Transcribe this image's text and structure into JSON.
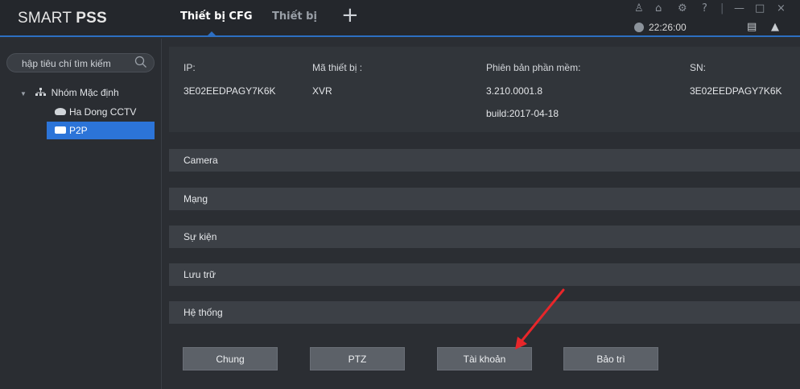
{
  "app": {
    "brand_prefix": "SMART ",
    "brand_bold": "PSS"
  },
  "tabs": [
    {
      "label": "Thiết bị CFG"
    },
    {
      "label": "Thiết bị"
    }
  ],
  "add_tab_symbol": "+",
  "top_icons": {
    "user": "♙",
    "lock": "⌂",
    "settings": "⚙",
    "help": "?",
    "minimize": "—",
    "maximize": "□",
    "close": "×"
  },
  "clock": "22:26:00",
  "tray": {
    "screen": "▤",
    "bell": "▲"
  },
  "search": {
    "text": "hập tiêu chí tìm kiếm"
  },
  "tree": {
    "group_label": "Nhóm Mặc định",
    "group_arrow": "▼",
    "items": [
      {
        "label": "Ha Dong CCTV"
      },
      {
        "label": "P2P"
      }
    ]
  },
  "device_info": {
    "ip_label": "IP:",
    "ip_value": "3E02EEDPAGY7K6K",
    "code_label": "Mã thiết bị :",
    "code_value": "XVR",
    "version_label": "Phiên bản phần mềm:",
    "version_value": "3.210.0001.8",
    "build_value": "build:2017-04-18",
    "sn_label": "SN:",
    "sn_value": "3E02EEDPAGY7K6K"
  },
  "sections": [
    {
      "label": "Camera"
    },
    {
      "label": "Mạng"
    },
    {
      "label": "Sự kiện"
    },
    {
      "label": "Lưu trữ"
    },
    {
      "label": "Hệ thống"
    }
  ],
  "system_buttons": [
    {
      "label": "Chung"
    },
    {
      "label": "PTZ"
    },
    {
      "label": "Tài khoản"
    },
    {
      "label": "Bảo trì"
    }
  ],
  "colors": {
    "accent": "#2d6fc2",
    "selected": "#2c74d8",
    "annotation_arrow": "#e8262a"
  }
}
